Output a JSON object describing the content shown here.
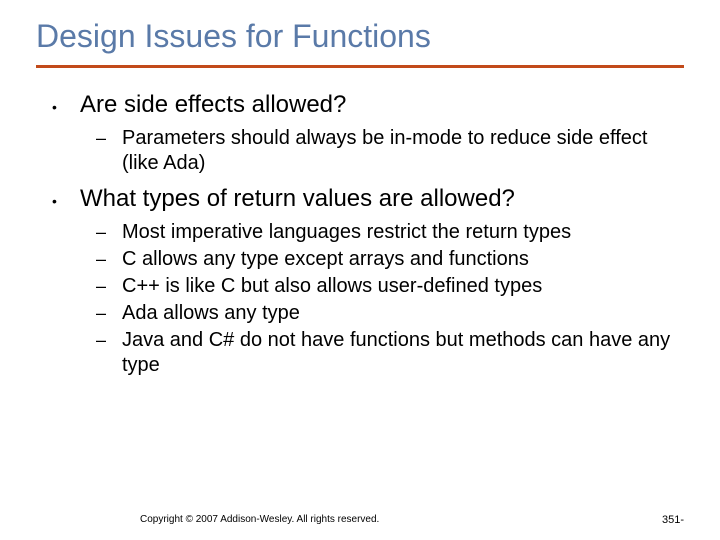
{
  "title": "Design Issues for Functions",
  "bullets": [
    {
      "text": "Are side effects allowed?",
      "sub": [
        "Parameters should always be in-mode to reduce side effect (like Ada)"
      ]
    },
    {
      "text": "What types of return values are allowed?",
      "sub": [
        "Most imperative languages restrict the return types",
        "C allows any type except arrays and functions",
        "C++ is like C but also allows user-defined types",
        "Ada allows any type",
        "Java and C# do not have functions but methods can have any type"
      ]
    }
  ],
  "footer": {
    "copyright": "Copyright © 2007 Addison-Wesley. All rights reserved.",
    "page": "351-"
  }
}
